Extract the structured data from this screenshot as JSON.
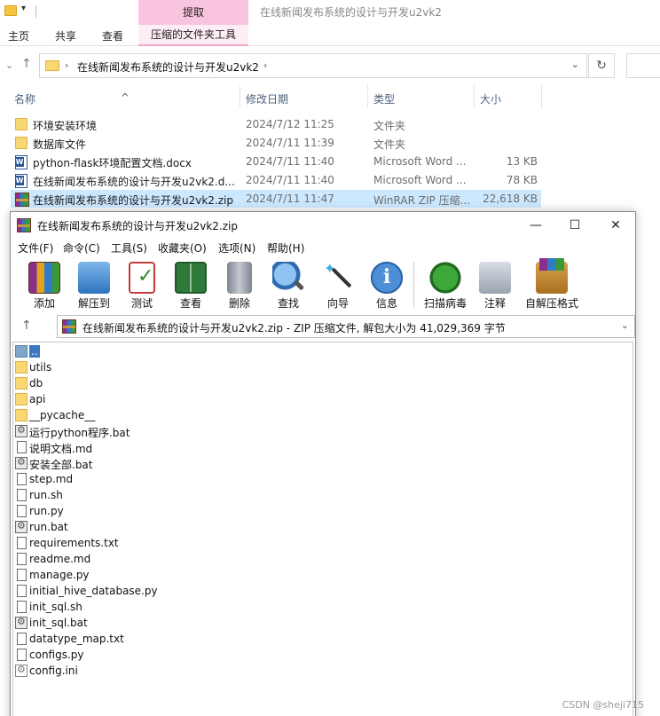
{
  "explorer": {
    "context_tab": "提取",
    "window_title": "在线新闻发布系统的设计与开发u2vk2",
    "ribbon_tabs": [
      "主页",
      "共享",
      "查看"
    ],
    "context_tool_tab": "压缩的文件夹工具",
    "address_path": "在线新闻发布系统的设计与开发u2vk2",
    "columns": {
      "name": "名称",
      "date": "修改日期",
      "type": "类型",
      "size": "大小"
    },
    "files": [
      {
        "name": "环境安装环境",
        "date": "2024/7/12 11:25",
        "type": "文件夹",
        "size": "",
        "icon": "folder-icon"
      },
      {
        "name": "数据库文件",
        "date": "2024/7/11 11:39",
        "type": "文件夹",
        "size": "",
        "icon": "folder-icon"
      },
      {
        "name": "python-flask环境配置文档.docx",
        "date": "2024/7/11 11:40",
        "type": "Microsoft Word ...",
        "size": "13 KB",
        "icon": "word-icon"
      },
      {
        "name": "在线新闻发布系统的设计与开发u2vk2.d...",
        "date": "2024/7/11 11:40",
        "type": "Microsoft Word ...",
        "size": "78 KB",
        "icon": "word-icon"
      },
      {
        "name": "在线新闻发布系统的设计与开发u2vk2.zip",
        "date": "2024/7/11 11:47",
        "type": "WinRAR ZIP 压缩...",
        "size": "22,618 KB",
        "icon": "zip-icon",
        "selected": true
      }
    ]
  },
  "winrar": {
    "title": "在线新闻发布系统的设计与开发u2vk2.zip",
    "window_controls": {
      "minimize": "—",
      "maximize": "☐",
      "close": "✕"
    },
    "menu": [
      "文件(F)",
      "命令(C)",
      "工具(S)",
      "收藏夹(O)",
      "选项(N)",
      "帮助(H)"
    ],
    "tools": [
      {
        "label": "添加",
        "icon": "add-archive-icon"
      },
      {
        "label": "解压到",
        "icon": "extract-to-icon"
      },
      {
        "label": "测试",
        "icon": "test-icon"
      },
      {
        "label": "查看",
        "icon": "view-icon"
      },
      {
        "label": "删除",
        "icon": "delete-icon"
      },
      {
        "label": "查找",
        "icon": "find-icon"
      },
      {
        "label": "向导",
        "icon": "wizard-icon"
      },
      {
        "label": "信息",
        "icon": "info-icon"
      },
      {
        "label": "扫描病毒",
        "icon": "virus-scan-icon"
      },
      {
        "label": "注释",
        "icon": "comment-icon"
      },
      {
        "label": "自解压格式",
        "icon": "sfx-icon"
      }
    ],
    "path_text": "在线新闻发布系统的设计与开发u2vk2.zip - ZIP 压缩文件, 解包大小为 41,029,369 字节",
    "items": [
      {
        "name": "..",
        "kind": "up"
      },
      {
        "name": "utils",
        "kind": "folder"
      },
      {
        "name": "db",
        "kind": "folder"
      },
      {
        "name": "api",
        "kind": "folder"
      },
      {
        "name": "__pycache__",
        "kind": "folder"
      },
      {
        "name": "运行python程序.bat",
        "kind": "bat"
      },
      {
        "name": "说明文档.md",
        "kind": "doc"
      },
      {
        "name": "安装全部.bat",
        "kind": "bat"
      },
      {
        "name": "step.md",
        "kind": "doc"
      },
      {
        "name": "run.sh",
        "kind": "doc"
      },
      {
        "name": "run.py",
        "kind": "doc"
      },
      {
        "name": "run.bat",
        "kind": "bat"
      },
      {
        "name": "requirements.txt",
        "kind": "doc"
      },
      {
        "name": "readme.md",
        "kind": "doc"
      },
      {
        "name": "manage.py",
        "kind": "doc"
      },
      {
        "name": "initial_hive_database.py",
        "kind": "doc"
      },
      {
        "name": "init_sql.sh",
        "kind": "doc"
      },
      {
        "name": "init_sql.bat",
        "kind": "bat"
      },
      {
        "name": "datatype_map.txt",
        "kind": "doc"
      },
      {
        "name": "configs.py",
        "kind": "doc"
      },
      {
        "name": "config.ini",
        "kind": "ini"
      }
    ]
  },
  "watermark": "CSDN @sheji715"
}
